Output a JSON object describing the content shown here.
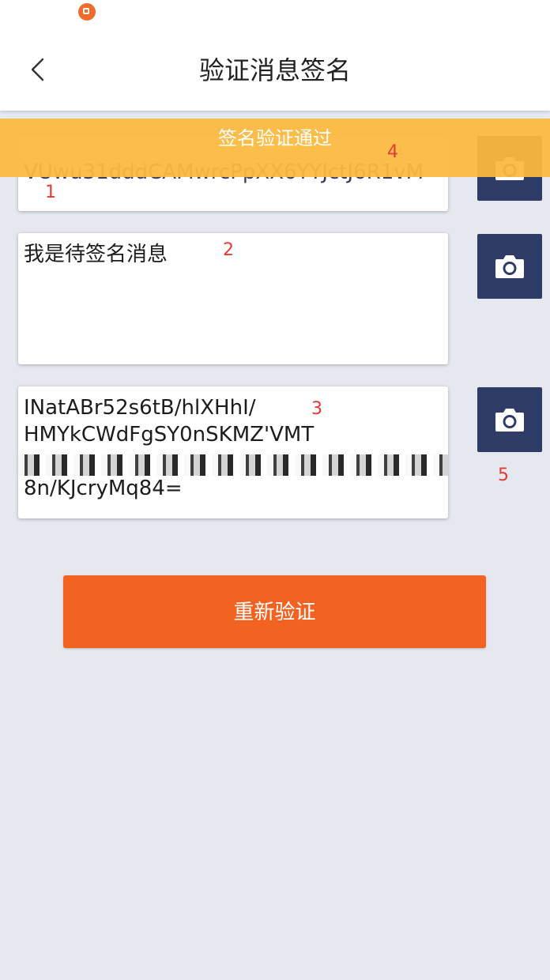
{
  "header": {
    "title": "验证消息签名"
  },
  "toast": {
    "message": "签名验证通过"
  },
  "fields": {
    "address": {
      "value": "VUwu31dddCAMwrcPpXX6YYJctJ6R1vM"
    },
    "message": {
      "value": "我是待签名消息"
    },
    "signature": {
      "value": "INatABr52s6tB/hlXHhI/\nHMYkCWdFgSY0nSKMZ'VMT\n\n8n/KJcryMq84="
    }
  },
  "markers": {
    "m1": "1",
    "m2": "2",
    "m3": "3",
    "m4": "4",
    "m5": "5"
  },
  "action": {
    "label": "重新验证"
  },
  "colors": {
    "accent": "#f26321",
    "toast": "#fcba3f",
    "camera_button": "#2e3c67",
    "background": "#e6e8f0"
  },
  "icons": {
    "back": "chevron-left-icon",
    "camera": "camera-icon"
  }
}
